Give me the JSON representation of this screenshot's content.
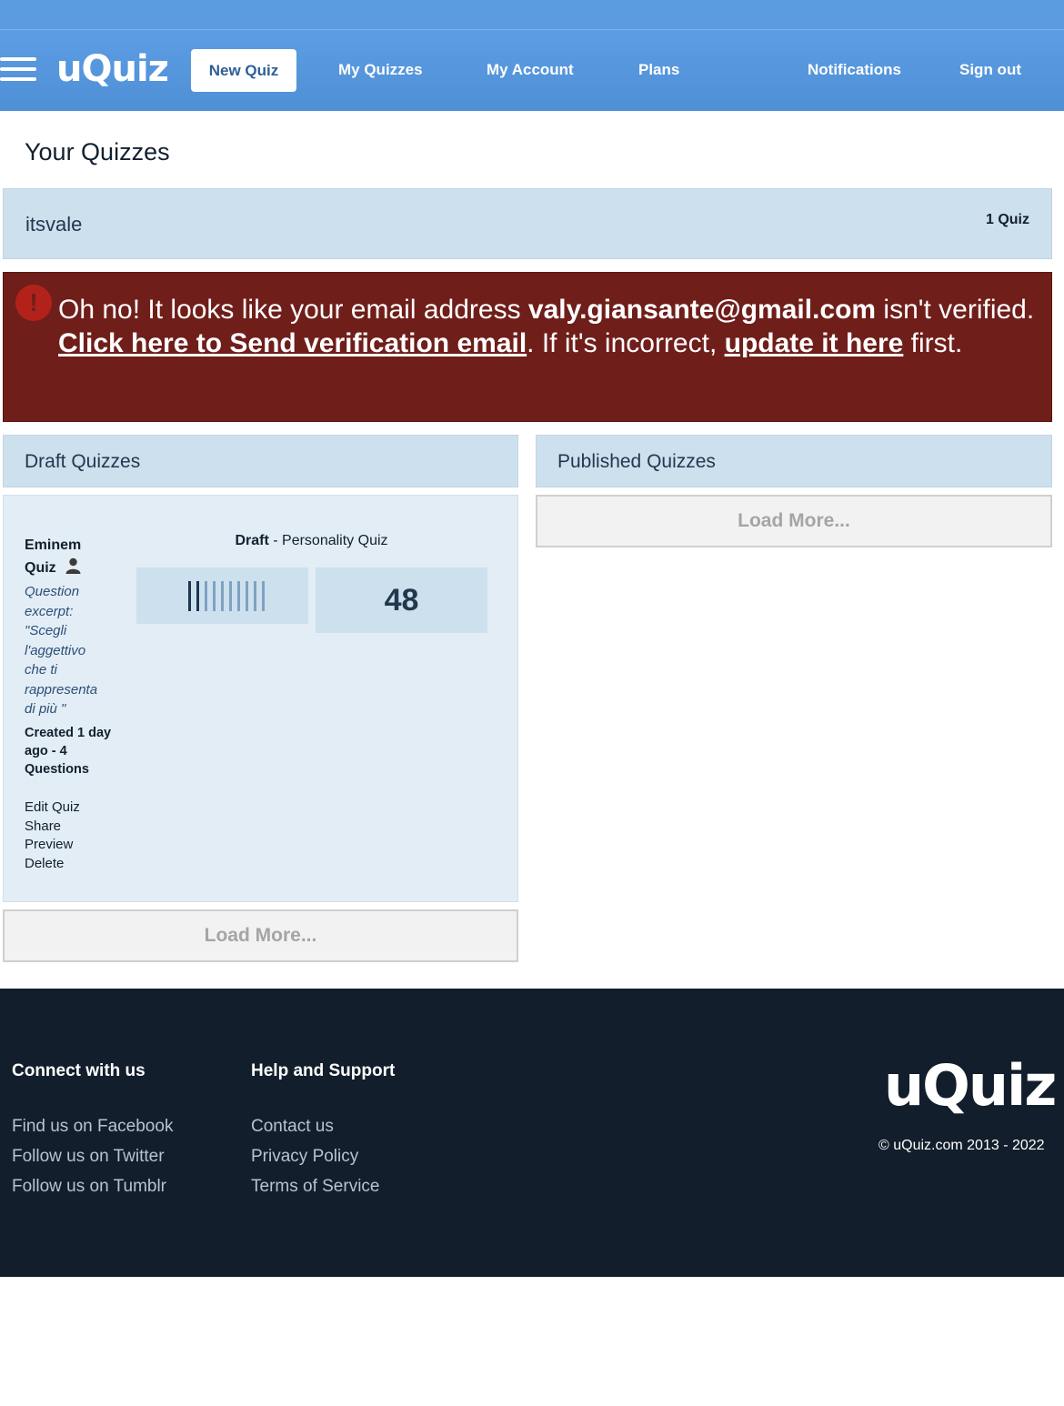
{
  "nav": {
    "logo": "uQuiz",
    "new_quiz": "New Quiz",
    "my_quizzes": "My Quizzes",
    "my_account": "My Account",
    "plans": "Plans",
    "notifications": "Notifications",
    "sign_out": "Sign out"
  },
  "page": {
    "title": "Your Quizzes",
    "user_name": "itsvale",
    "quiz_count": "1 Quiz"
  },
  "alert": {
    "icon": "!",
    "prefix": "Oh no! It looks like your email address ",
    "email": "valy.giansante@gmail.com",
    "middle": " isn't verified. ",
    "send_link": "Click here to Send verification email",
    "after_send": ". If it's incorrect, ",
    "update_link": "update it here",
    "suffix": " first."
  },
  "drafts": {
    "heading": "Draft Quizzes",
    "load_more": "Load More...",
    "quiz": {
      "title": "Eminem Quiz",
      "excerpt": "Question excerpt: \"Scegli l'aggettivo che ti rappresenta di più \"",
      "meta": "Created 1 day ago - 4 Questions",
      "status": "Draft",
      "type": " - Personality Quiz",
      "score": "48",
      "actions": [
        "Edit Quiz",
        "Share",
        "Preview",
        "Delete"
      ]
    }
  },
  "published": {
    "heading": "Published Quizzes",
    "load_more": "Load More..."
  },
  "footer": {
    "connect_heading": "Connect with us",
    "connect_links": [
      "Find us on Facebook",
      "Follow us on Twitter",
      "Follow us on Tumblr"
    ],
    "help_heading": "Help and Support",
    "help_links": [
      "Contact us",
      "Privacy Policy",
      "Terms of Service"
    ],
    "logo": "uQuiz",
    "copyright": "© uQuiz.com 2013 - 2022"
  },
  "colors": {
    "nav_blue": "#5c9de3",
    "alert_red": "#6f1e1a",
    "panel_blue": "#cde0ee",
    "footer_dark": "#121e2b"
  }
}
